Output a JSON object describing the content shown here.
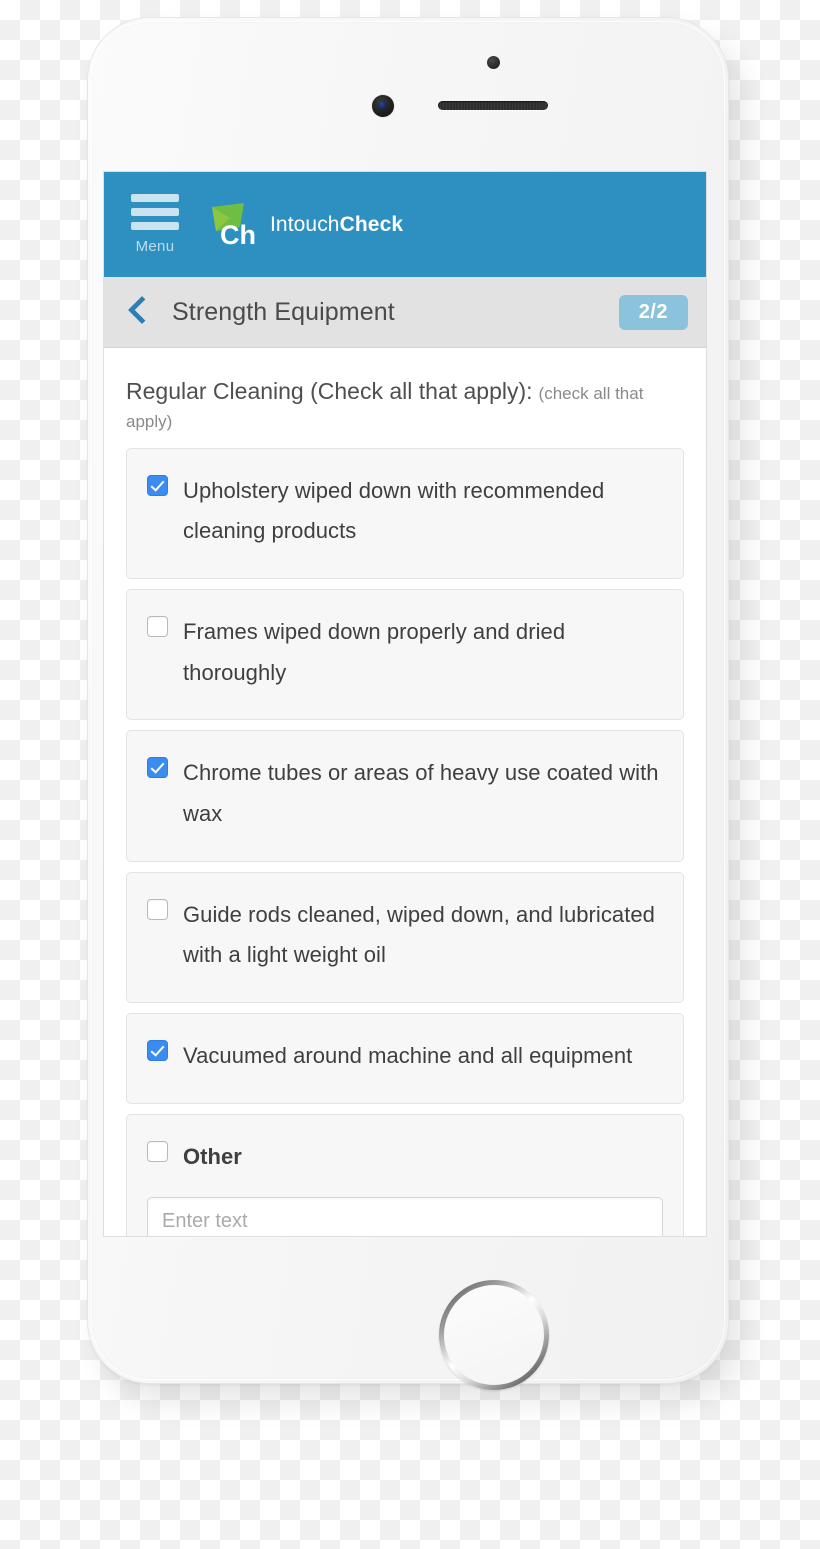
{
  "app": {
    "header": {
      "menu_label": "Menu",
      "menu_icon": "hamburger-icon",
      "logo_mark_text": "Ch",
      "brand_name_light": "Intouch",
      "brand_name_bold": "Check",
      "header_color": "#2d90c0",
      "logo_green": "#6fbe44"
    },
    "sub_nav": {
      "back_icon": "chevron-left-icon",
      "title": "Strength Equipment",
      "progress_badge": "2/2",
      "badge_color": "#8bc3dd",
      "bar_color": "#e2e2e2"
    },
    "content": {
      "question_text": "Regular Cleaning (Check all that apply):",
      "question_hint": "(check all that apply)",
      "checkbox_checked_color": "#3b8cf0",
      "options": [
        {
          "label": "Upholstery wiped down with recommended cleaning products",
          "checked": true
        },
        {
          "label": "Frames wiped down properly and dried thoroughly",
          "checked": false
        },
        {
          "label": "Chrome tubes or areas of heavy use coated with wax",
          "checked": true
        },
        {
          "label": "Guide rods cleaned, wiped down, and lubricated with a light weight oil",
          "checked": false
        },
        {
          "label": "Vacuumed around machine and all equipment",
          "checked": true
        },
        {
          "label": "Other",
          "checked": false,
          "has_text_input": true,
          "input_value": "",
          "input_placeholder": "Enter text"
        }
      ]
    }
  },
  "device": {
    "type": "smartphone",
    "hardware": {
      "front_camera": "camera-icon",
      "earpiece_speaker": "speaker-grille",
      "sensor": "proximity-sensor",
      "home_button": "home-button"
    }
  }
}
